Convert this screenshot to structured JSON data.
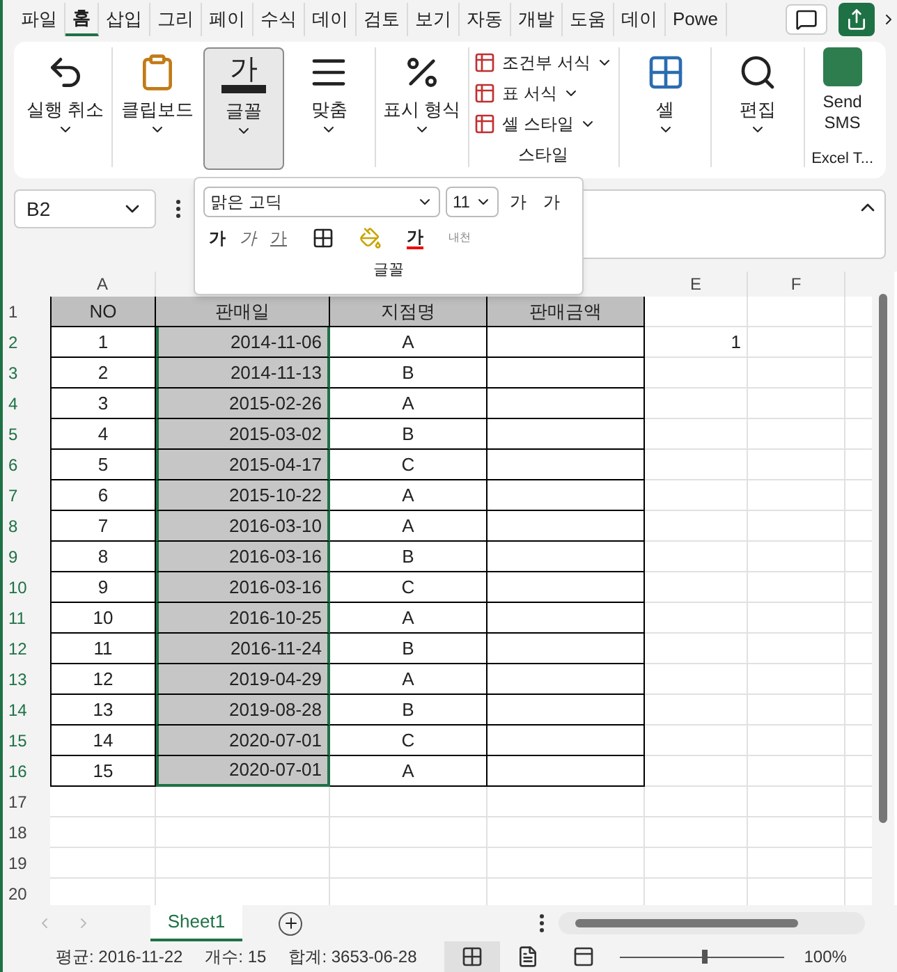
{
  "ribbon_tabs": [
    {
      "label": "파일",
      "selected": false
    },
    {
      "label": "홈",
      "selected": true
    },
    {
      "label": "삽입",
      "selected": false
    },
    {
      "label": "그리",
      "selected": false
    },
    {
      "label": "페이",
      "selected": false
    },
    {
      "label": "수식",
      "selected": false
    },
    {
      "label": "데이",
      "selected": false
    },
    {
      "label": "검토",
      "selected": false
    },
    {
      "label": "보기",
      "selected": false
    },
    {
      "label": "자동",
      "selected": false
    },
    {
      "label": "개발",
      "selected": false
    },
    {
      "label": "도움",
      "selected": false
    },
    {
      "label": "데이",
      "selected": false
    },
    {
      "label": "Powe",
      "selected": false
    }
  ],
  "ribbon": {
    "undo": "실행 취소",
    "clipboard": "클립보드",
    "font": {
      "label": "글꼴",
      "selected": true,
      "icon_text": "가"
    },
    "alignment": "맞춤",
    "number_format": "표시 형식",
    "styles": [
      "조건부 서식",
      "표 서식",
      "셀 스타일"
    ],
    "styles_group": "스타일",
    "cells": "셀",
    "editing": "편집",
    "send_sms": "Send SMS",
    "addin_group": "Excel T..."
  },
  "font_popup": {
    "font_name": "맑은 고딕",
    "font_size": "11",
    "grow": "가",
    "shrink": "가",
    "bold": "가",
    "italic": "가",
    "underline": "가",
    "font_color": "가",
    "phonetic": "내천",
    "group_label": "글꼴"
  },
  "name_box": "B2",
  "columns": [
    "A",
    "E",
    "F"
  ],
  "rows": [
    {
      "number": "1",
      "kind": "header",
      "selected": false,
      "column_a": "NO",
      "column_b": "판매일",
      "column_c": "지점명",
      "column_d": "판매금액"
    },
    {
      "number": "2",
      "kind": "data",
      "selected": true,
      "column_a": "1",
      "column_b": "2014-11-06",
      "column_c": "A",
      "column_e": "1"
    },
    {
      "number": "3",
      "kind": "data",
      "selected": true,
      "column_a": "2",
      "column_b": "2014-11-13",
      "column_c": "B"
    },
    {
      "number": "4",
      "kind": "data",
      "selected": true,
      "column_a": "3",
      "column_b": "2015-02-26",
      "column_c": "A"
    },
    {
      "number": "5",
      "kind": "data",
      "selected": true,
      "column_a": "4",
      "column_b": "2015-03-02",
      "column_c": "B"
    },
    {
      "number": "6",
      "kind": "data",
      "selected": true,
      "column_a": "5",
      "column_b": "2015-04-17",
      "column_c": "C"
    },
    {
      "number": "7",
      "kind": "data",
      "selected": true,
      "column_a": "6",
      "column_b": "2015-10-22",
      "column_c": "A"
    },
    {
      "number": "8",
      "kind": "data",
      "selected": true,
      "column_a": "7",
      "column_b": "2016-03-10",
      "column_c": "A"
    },
    {
      "number": "9",
      "kind": "data",
      "selected": true,
      "column_a": "8",
      "column_b": "2016-03-16",
      "column_c": "B"
    },
    {
      "number": "10",
      "kind": "data",
      "selected": true,
      "column_a": "9",
      "column_b": "2016-03-16",
      "column_c": "C"
    },
    {
      "number": "11",
      "kind": "data",
      "selected": true,
      "column_a": "10",
      "column_b": "2016-10-25",
      "column_c": "A"
    },
    {
      "number": "12",
      "kind": "data",
      "selected": true,
      "column_a": "11",
      "column_b": "2016-11-24",
      "column_c": "B"
    },
    {
      "number": "13",
      "kind": "data",
      "selected": true,
      "column_a": "12",
      "column_b": "2019-04-29",
      "column_c": "A"
    },
    {
      "number": "14",
      "kind": "data",
      "selected": true,
      "column_a": "13",
      "column_b": "2019-08-28",
      "column_c": "B"
    },
    {
      "number": "15",
      "kind": "data",
      "selected": true,
      "column_a": "14",
      "column_b": "2020-07-01",
      "column_c": "C"
    },
    {
      "number": "16",
      "kind": "data",
      "selected": true,
      "column_a": "15",
      "column_b": "2020-07-01",
      "column_c": "A"
    },
    {
      "number": "17",
      "kind": "empty",
      "selected": false
    },
    {
      "number": "18",
      "kind": "empty",
      "selected": false
    },
    {
      "number": "19",
      "kind": "empty",
      "selected": false
    },
    {
      "number": "20",
      "kind": "empty",
      "selected": false
    }
  ],
  "sheet_tabs": [
    {
      "label": "Sheet1",
      "selected": true
    }
  ],
  "status_bar": {
    "average": "평균: 2016-11-22",
    "count": "개수: 15",
    "sum": "합계: 3653-06-28",
    "zoom": "100%",
    "zoom_slider": {
      "level": 0.5
    }
  }
}
